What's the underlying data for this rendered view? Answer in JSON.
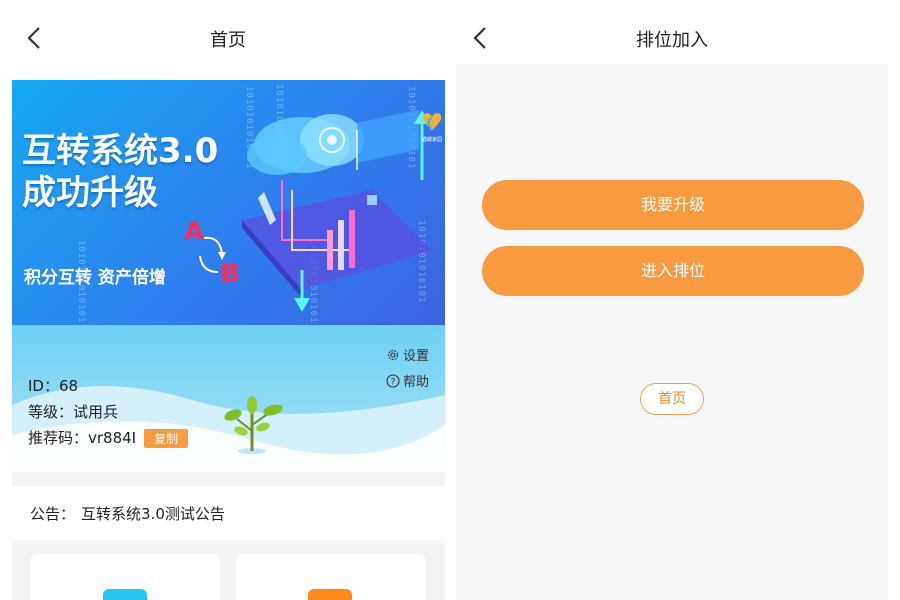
{
  "left_screen": {
    "title": "首页",
    "banner": {
      "title_line1": "互转系统3.0",
      "title_line2": "成功升级",
      "subtitle": "积分互转  资产倍增",
      "letter_a": "A",
      "letter_b": "B",
      "binary_text": "1010101010101",
      "logo_text": "遇蝶家园"
    },
    "profile": {
      "settings_label": "设置",
      "help_label": "帮助",
      "id_text": "ID：68",
      "level_text": "等级：试用兵",
      "referral_text": "推荐码：vr884I",
      "copy_label": "复制"
    },
    "notice": {
      "label": "公告：",
      "text": "互转系统3.0测试公告"
    },
    "colors": {
      "accent": "#f59b42",
      "banner_blue": "#2f7fee",
      "card_icon_1": "#29c3f0",
      "card_icon_2": "#ff8a1c"
    }
  },
  "right_screen": {
    "title": "排位加入",
    "upgrade_button": "我要升级",
    "join_button": "进入排位",
    "home_button": "首页",
    "colors": {
      "button": "#f89a40",
      "panel": "#f7f7f7"
    }
  }
}
